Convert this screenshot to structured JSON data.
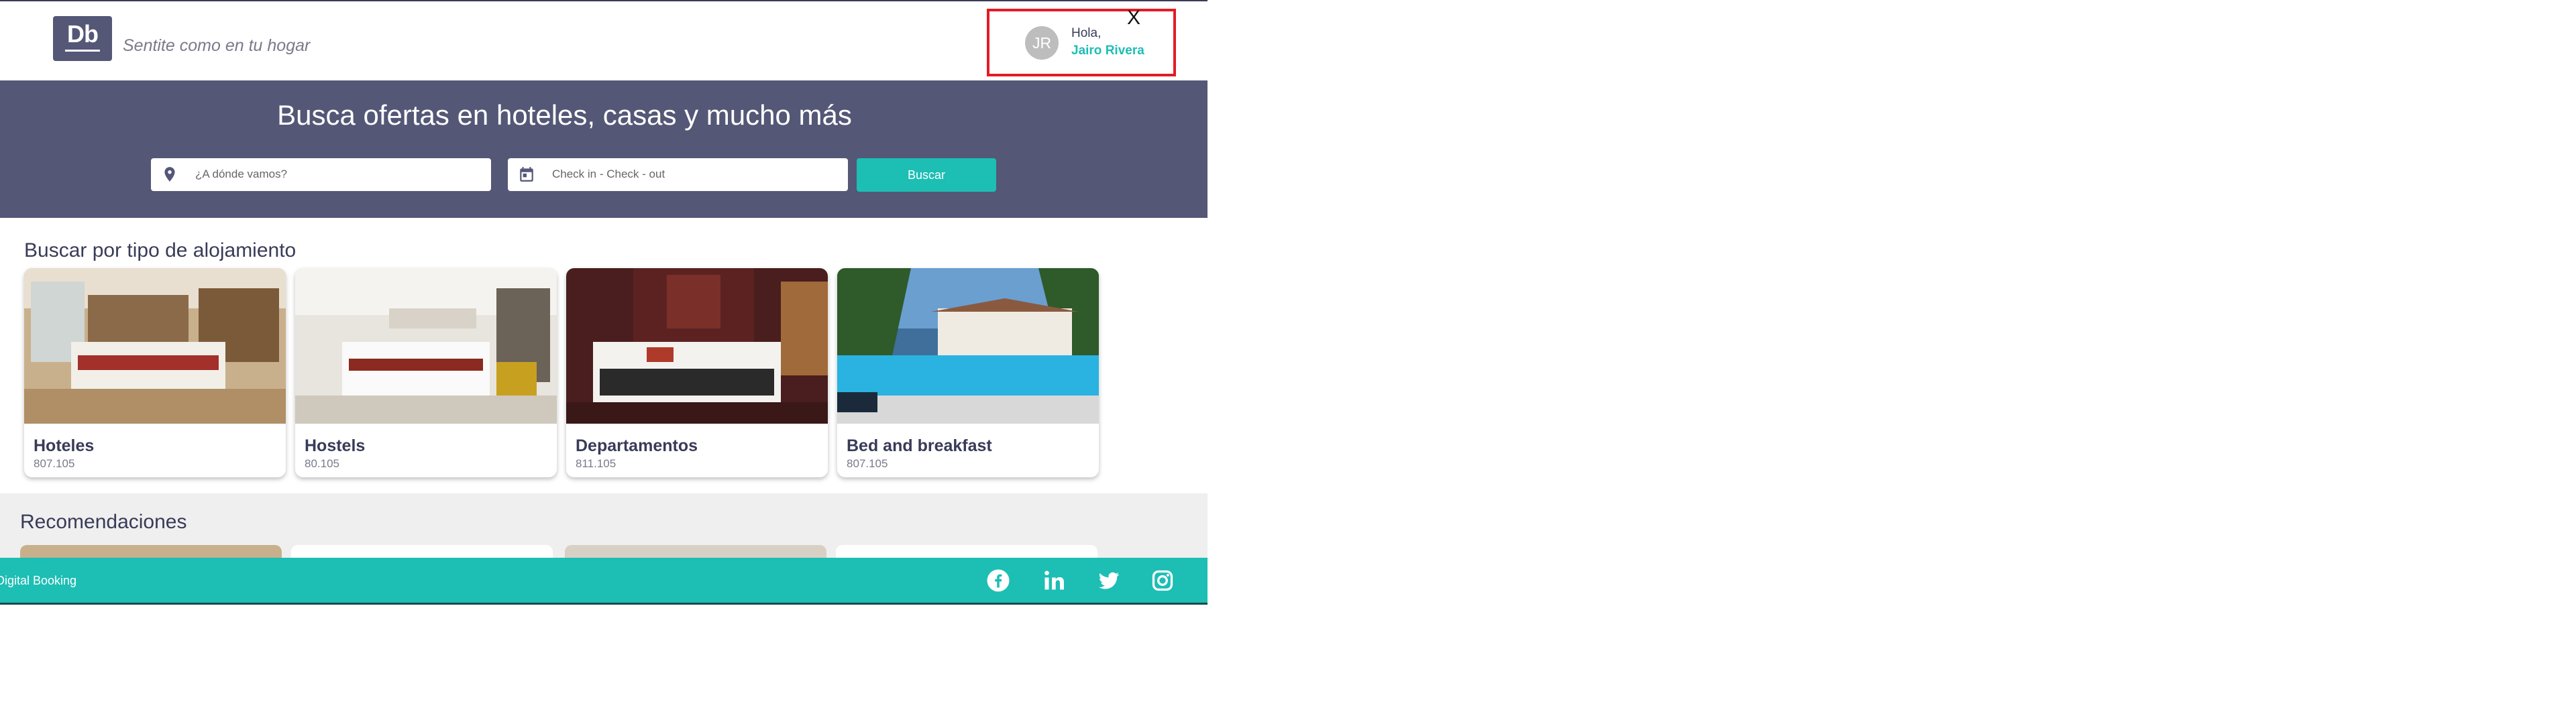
{
  "header": {
    "logo_text": "Db",
    "slogan": "Sentite como en tu hogar",
    "user": {
      "initials": "JR",
      "greeting": "Hola,",
      "name": "Jairo Rivera",
      "close_label": "X"
    }
  },
  "search": {
    "title": "Busca ofertas en hoteles, casas y mucho más",
    "destination_placeholder": "¿A dónde vamos?",
    "dates_placeholder": "Check in - Check - out",
    "button_label": "Buscar"
  },
  "categories": {
    "title": "Buscar por tipo de alojamiento",
    "items": [
      {
        "label": "Hoteles",
        "count": "807.105"
      },
      {
        "label": "Hostels",
        "count": "80.105"
      },
      {
        "label": "Departamentos",
        "count": "811.105"
      },
      {
        "label": "Bed and breakfast",
        "count": "807.105"
      }
    ]
  },
  "recommendations": {
    "title": "Recomendaciones"
  },
  "footer": {
    "copyright": "Digital Booking",
    "social_icons": [
      "facebook-icon",
      "linkedin-icon",
      "twitter-icon",
      "instagram-icon"
    ]
  },
  "colors": {
    "primary": "#545776",
    "accent": "#1dbeb4",
    "dark_text": "#383b58",
    "highlight_border": "#e31b23"
  }
}
